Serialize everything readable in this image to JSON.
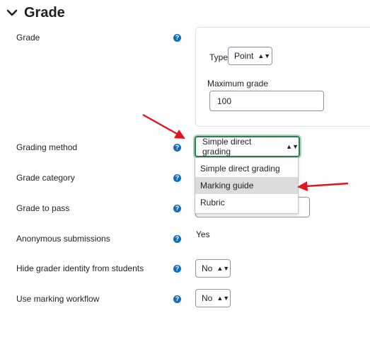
{
  "section": {
    "title": "Grade"
  },
  "fields": {
    "grade": {
      "label": "Grade"
    },
    "type": {
      "label": "Type",
      "value": "Point"
    },
    "max_grade": {
      "label": "Maximum grade",
      "value": "100"
    },
    "grading_method": {
      "label": "Grading method",
      "value": "Simple direct grading",
      "options": [
        "Simple direct grading",
        "Marking guide",
        "Rubric"
      ],
      "highlighted": "Marking guide"
    },
    "grade_category": {
      "label": "Grade category"
    },
    "grade_to_pass": {
      "label": "Grade to pass"
    },
    "anonymous": {
      "label": "Anonymous submissions",
      "value": "Yes"
    },
    "hide_grader": {
      "label": "Hide grader identity from students",
      "value": "No"
    },
    "marking_workflow": {
      "label": "Use marking workflow",
      "value": "No"
    }
  },
  "help_glyph": "?",
  "colors": {
    "accent": "#0f6cbf",
    "focus": "#2e7d50",
    "arrow": "#e0161c"
  }
}
